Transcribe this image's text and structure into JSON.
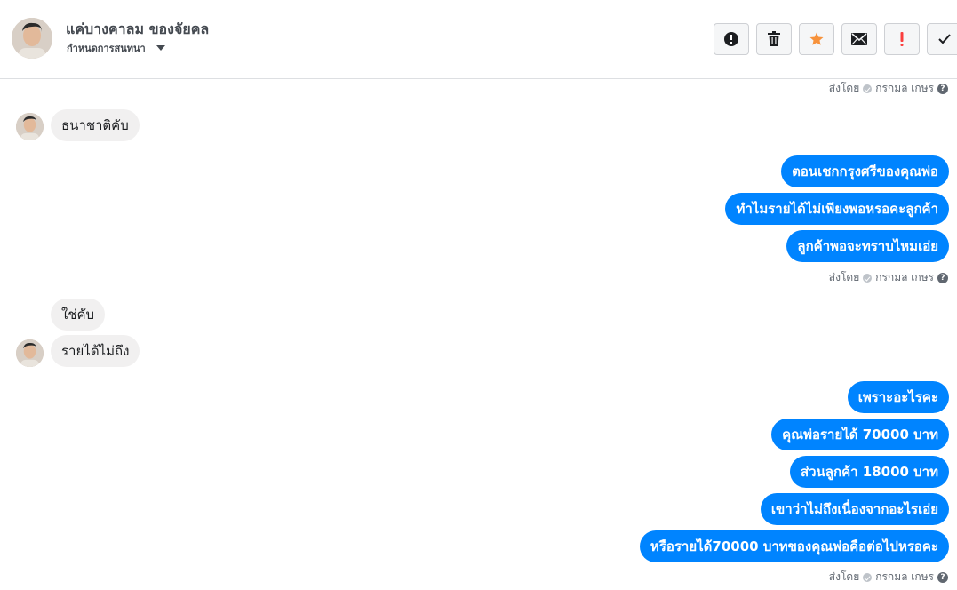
{
  "header": {
    "contact_name": "แค่บางคาลม ของจัยคล",
    "subtitle": "กำหนดการสนทนา",
    "tools": [
      {
        "name": "report-icon"
      },
      {
        "name": "trash-icon"
      },
      {
        "name": "star-icon"
      },
      {
        "name": "mail-icon"
      },
      {
        "name": "exclamation-icon"
      },
      {
        "name": "check-icon"
      }
    ]
  },
  "seen_label": "ส่งโดย",
  "seen_by": "กรกมล เกษร",
  "messages": {
    "in_1": "ธนาชาติคับ",
    "out_1": "ตอนเชกกรุงศรีของคุณพ่อ",
    "out_2": "ทำไมรายได้ไม่เพียงพอหรอคะลูกค้า",
    "out_3": "ลูกค้าพอจะทราบไหมเอ่ย",
    "in_2": "ใช่คับ",
    "in_3": "รายได้ไม่ถึง",
    "out_4": "เพราะอะไรคะ",
    "out_5": "คุณพ่อรายได้ 70000 บาท",
    "out_6": "ส่วนลูกค้า 18000 บาท",
    "out_7": "เขาว่าไม่ถึงเนื่องจากอะไรเอ่ย",
    "out_8": "หรือรายได้70000 บาทของคุณพ่อคือต่อไปหรอคะ"
  },
  "colors": {
    "outgoing_bubble": "#0084ff",
    "incoming_bubble": "#f1f0f0",
    "star": "#f7923b",
    "exclamation": "#fa3e3e"
  }
}
